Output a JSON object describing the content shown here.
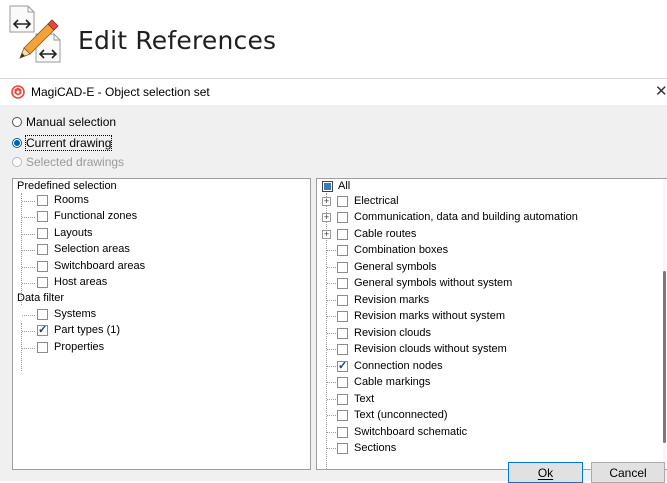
{
  "header": {
    "title": "Edit References",
    "icon": "edit-references-icon"
  },
  "window": {
    "title": "MagiCAD-E - Object selection set",
    "close_symbol": "✕"
  },
  "selection_mode": {
    "options": [
      {
        "label": "Manual selection",
        "selected": false,
        "enabled": true
      },
      {
        "label": "Current drawing",
        "selected": true,
        "enabled": true
      },
      {
        "label": "Selected drawings",
        "selected": false,
        "enabled": false
      }
    ]
  },
  "left_tree": {
    "groups": [
      {
        "label": "Predefined selection",
        "items": [
          {
            "label": "Rooms",
            "checked": false
          },
          {
            "label": "Functional zones",
            "checked": false
          },
          {
            "label": "Layouts",
            "checked": false
          },
          {
            "label": "Selection areas",
            "checked": false
          },
          {
            "label": "Switchboard areas",
            "checked": false
          },
          {
            "label": "Host areas",
            "checked": false
          }
        ]
      },
      {
        "label": "Data filter",
        "items": [
          {
            "label": "Systems",
            "checked": false
          },
          {
            "label": "Part types (1)",
            "checked": true
          },
          {
            "label": "Properties",
            "checked": false
          }
        ]
      }
    ]
  },
  "right_tree": {
    "root": {
      "label": "All",
      "state": "partial"
    },
    "items": [
      {
        "label": "Electrical",
        "checked": false,
        "expandable": true
      },
      {
        "label": "Communication, data and building automation",
        "checked": false,
        "expandable": true
      },
      {
        "label": "Cable routes",
        "checked": false,
        "expandable": true
      },
      {
        "label": "Combination boxes",
        "checked": false,
        "expandable": false
      },
      {
        "label": "General symbols",
        "checked": false,
        "expandable": false
      },
      {
        "label": "General symbols without system",
        "checked": false,
        "expandable": false
      },
      {
        "label": "Revision marks",
        "checked": false,
        "expandable": false
      },
      {
        "label": "Revision marks without system",
        "checked": false,
        "expandable": false
      },
      {
        "label": "Revision clouds",
        "checked": false,
        "expandable": false
      },
      {
        "label": "Revision clouds without system",
        "checked": false,
        "expandable": false
      },
      {
        "label": "Connection nodes",
        "checked": true,
        "expandable": false
      },
      {
        "label": "Cable markings",
        "checked": false,
        "expandable": false
      },
      {
        "label": "Text",
        "checked": false,
        "expandable": false
      },
      {
        "label": "Text (unconnected)",
        "checked": false,
        "expandable": false
      },
      {
        "label": "Switchboard schematic",
        "checked": false,
        "expandable": false
      },
      {
        "label": "Sections",
        "checked": false,
        "expandable": false
      }
    ]
  },
  "buttons": {
    "ok_label": "Ok",
    "cancel_label": "Cancel"
  },
  "colors": {
    "accent": "#0063b1",
    "dialog_bg": "#f0f0f0",
    "app_icon": "#e8473c"
  }
}
